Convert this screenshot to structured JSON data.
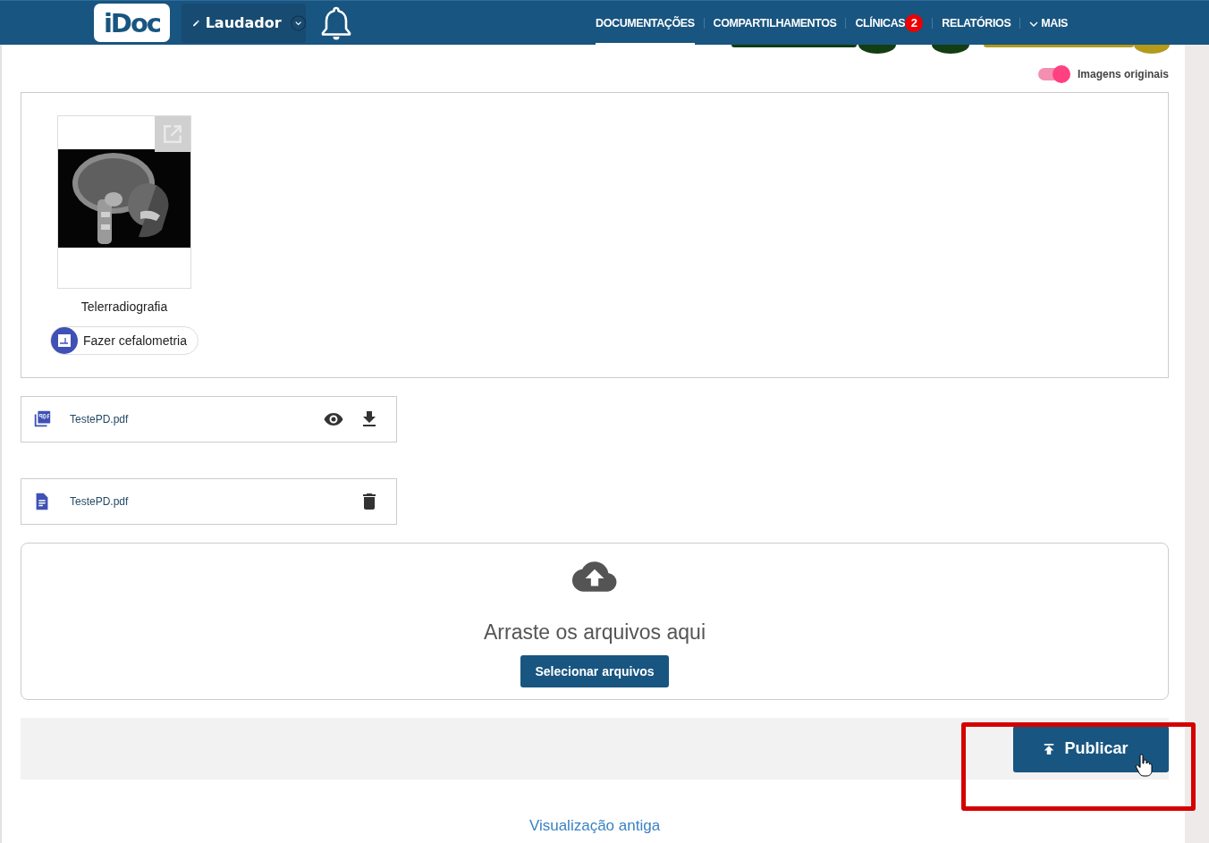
{
  "header": {
    "logo": "iDoc",
    "profile": {
      "label": "Laudador"
    },
    "nav": [
      {
        "label": "DOCUMENTAÇÕES",
        "selected": true
      },
      {
        "label": "COMPARTILHAMENTOS",
        "selected": false
      },
      {
        "label": "CLÍNICAS",
        "selected": false,
        "badge": "2"
      },
      {
        "label": "RELATÓRIOS",
        "selected": false
      },
      {
        "label": "MAIS",
        "selected": false,
        "kind": "menu"
      }
    ]
  },
  "toggle": {
    "label": "Imagens originais",
    "on": true
  },
  "images": [
    {
      "kind": "picture",
      "caption": "Telerradiografia",
      "action": "Fazer cefalometria"
    }
  ],
  "files": [
    {
      "name": "TestePD.pdf",
      "kind": "published"
    },
    {
      "name": "TestePD.pdf",
      "kind": "pending"
    }
  ],
  "dropzone": {
    "text": "Arraste os arquivos aqui",
    "button": "Selecionar arquivos"
  },
  "publish_button": "Publicar",
  "old_view_link": "Visualização antiga"
}
